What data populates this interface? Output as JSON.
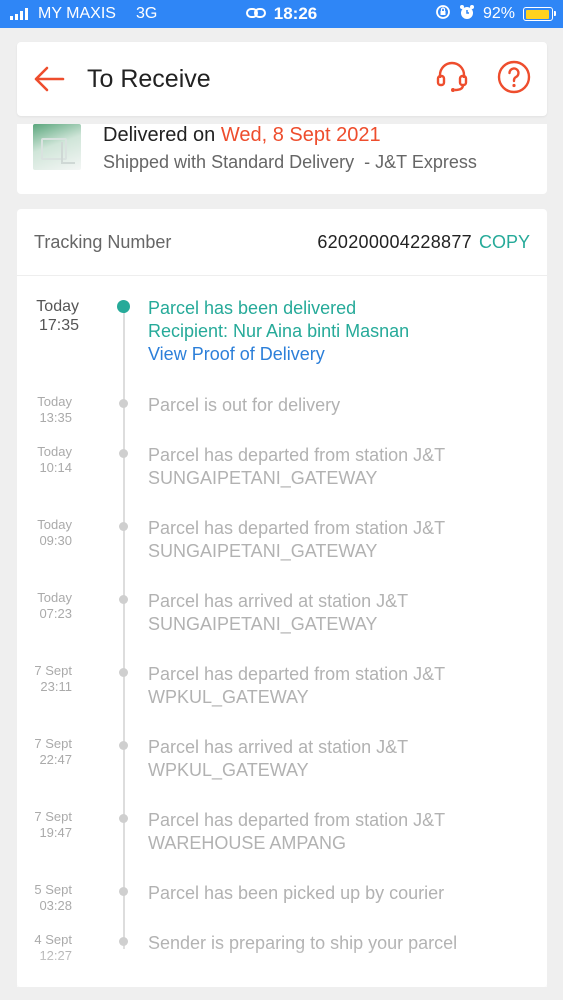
{
  "status_bar": {
    "carrier": "MY MAXIS",
    "network": "3G",
    "time": "18:26",
    "battery": "92%",
    "battery_level": 0.92,
    "battery_color": "#ffd21f",
    "bg_color": "#2f86f6"
  },
  "header": {
    "title": "To Receive",
    "back_icon": "back-arrow-icon",
    "support_icon": "headset-icon",
    "help_icon": "question-circle-icon",
    "accent_color": "#ee4d2d"
  },
  "summary": {
    "delivered_prefix": "Delivered on",
    "delivered_date": "Wed, 8 Sept 2021",
    "shipping": "Shipped with Standard Delivery  - J&T Express"
  },
  "tracking": {
    "label": "Tracking Number",
    "number": "620200004228877",
    "copy_label": "COPY",
    "accent_color": "#26aa99",
    "link_color": "#2c7fd9",
    "events": [
      {
        "date": "Today",
        "time": "17:35",
        "lines": [
          "Parcel has been delivered",
          "Recipient: Nur Aina binti Masnan"
        ],
        "link": "View Proof of Delivery"
      },
      {
        "date": "Today",
        "time": "13:35",
        "lines": [
          "Parcel is out for delivery"
        ]
      },
      {
        "date": "Today",
        "time": "10:14",
        "lines": [
          "Parcel has departed from station J&T",
          "SUNGAIPETANI_GATEWAY"
        ]
      },
      {
        "date": "Today",
        "time": "09:30",
        "lines": [
          "Parcel has departed from station J&T",
          "SUNGAIPETANI_GATEWAY"
        ]
      },
      {
        "date": "Today",
        "time": "07:23",
        "lines": [
          "Parcel has arrived at station J&T",
          "SUNGAIPETANI_GATEWAY"
        ]
      },
      {
        "date": "7 Sept",
        "time": "23:11",
        "lines": [
          "Parcel has departed from station J&T",
          "WPKUL_GATEWAY"
        ]
      },
      {
        "date": "7 Sept",
        "time": "22:47",
        "lines": [
          "Parcel has arrived at station J&T",
          "WPKUL_GATEWAY"
        ]
      },
      {
        "date": "7 Sept",
        "time": "19:47",
        "lines": [
          "Parcel has departed from station J&T",
          "WAREHOUSE AMPANG"
        ]
      },
      {
        "date": "5 Sept",
        "time": "03:28",
        "lines": [
          "Parcel has been picked up by courier"
        ]
      },
      {
        "date": "4 Sept",
        "time": "12:27",
        "lines": [
          "Sender is preparing to ship your parcel"
        ]
      }
    ]
  }
}
